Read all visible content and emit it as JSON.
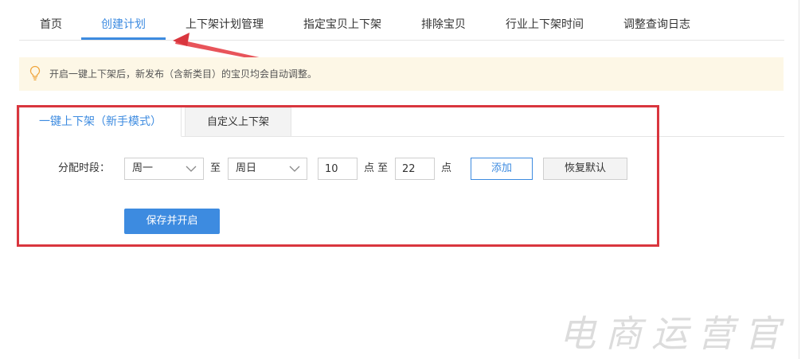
{
  "nav": {
    "tabs": [
      "首页",
      "创建计划",
      "上下架计划管理",
      "指定宝贝上下架",
      "排除宝贝",
      "行业上下架时间",
      "调整查询日志"
    ],
    "active_index": 1
  },
  "notice": {
    "icon": "lightbulb-icon",
    "text": "开启一键上下架后，新发布（含新类目）的宝贝均会自动调整。"
  },
  "subtabs": {
    "active": "一键上下架（新手模式）",
    "other": "自定义上下架"
  },
  "form": {
    "period_label": "分配时段：",
    "start_day": "周一",
    "to_label": "至",
    "end_day": "周日",
    "start_hour": "10",
    "hour_to_label": "点 至",
    "end_hour": "22",
    "hour_unit": "点",
    "add_button": "添加",
    "reset_button": "恢复默认",
    "save_button": "保存并开启"
  },
  "watermark": "电商运营官",
  "colors": {
    "accent": "#3d8be0",
    "highlight": "#d9363e",
    "notice_bg": "#fdf7e6"
  }
}
